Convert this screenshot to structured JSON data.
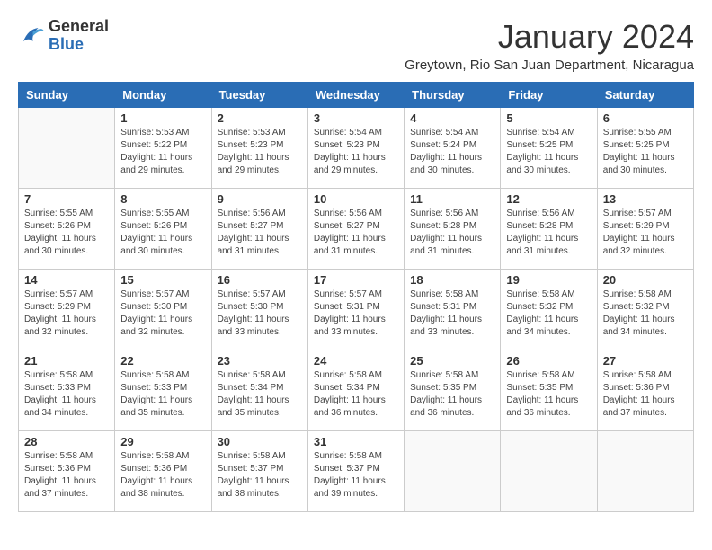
{
  "logo": {
    "general": "General",
    "blue": "Blue"
  },
  "title": "January 2024",
  "subtitle": "Greytown, Rio San Juan Department, Nicaragua",
  "days_of_week": [
    "Sunday",
    "Monday",
    "Tuesday",
    "Wednesday",
    "Thursday",
    "Friday",
    "Saturday"
  ],
  "weeks": [
    [
      {
        "day": "",
        "info": ""
      },
      {
        "day": "1",
        "info": "Sunrise: 5:53 AM\nSunset: 5:22 PM\nDaylight: 11 hours\nand 29 minutes."
      },
      {
        "day": "2",
        "info": "Sunrise: 5:53 AM\nSunset: 5:23 PM\nDaylight: 11 hours\nand 29 minutes."
      },
      {
        "day": "3",
        "info": "Sunrise: 5:54 AM\nSunset: 5:23 PM\nDaylight: 11 hours\nand 29 minutes."
      },
      {
        "day": "4",
        "info": "Sunrise: 5:54 AM\nSunset: 5:24 PM\nDaylight: 11 hours\nand 30 minutes."
      },
      {
        "day": "5",
        "info": "Sunrise: 5:54 AM\nSunset: 5:25 PM\nDaylight: 11 hours\nand 30 minutes."
      },
      {
        "day": "6",
        "info": "Sunrise: 5:55 AM\nSunset: 5:25 PM\nDaylight: 11 hours\nand 30 minutes."
      }
    ],
    [
      {
        "day": "7",
        "info": "Sunrise: 5:55 AM\nSunset: 5:26 PM\nDaylight: 11 hours\nand 30 minutes."
      },
      {
        "day": "8",
        "info": "Sunrise: 5:55 AM\nSunset: 5:26 PM\nDaylight: 11 hours\nand 30 minutes."
      },
      {
        "day": "9",
        "info": "Sunrise: 5:56 AM\nSunset: 5:27 PM\nDaylight: 11 hours\nand 31 minutes."
      },
      {
        "day": "10",
        "info": "Sunrise: 5:56 AM\nSunset: 5:27 PM\nDaylight: 11 hours\nand 31 minutes."
      },
      {
        "day": "11",
        "info": "Sunrise: 5:56 AM\nSunset: 5:28 PM\nDaylight: 11 hours\nand 31 minutes."
      },
      {
        "day": "12",
        "info": "Sunrise: 5:56 AM\nSunset: 5:28 PM\nDaylight: 11 hours\nand 31 minutes."
      },
      {
        "day": "13",
        "info": "Sunrise: 5:57 AM\nSunset: 5:29 PM\nDaylight: 11 hours\nand 32 minutes."
      }
    ],
    [
      {
        "day": "14",
        "info": "Sunrise: 5:57 AM\nSunset: 5:29 PM\nDaylight: 11 hours\nand 32 minutes."
      },
      {
        "day": "15",
        "info": "Sunrise: 5:57 AM\nSunset: 5:30 PM\nDaylight: 11 hours\nand 32 minutes."
      },
      {
        "day": "16",
        "info": "Sunrise: 5:57 AM\nSunset: 5:30 PM\nDaylight: 11 hours\nand 33 minutes."
      },
      {
        "day": "17",
        "info": "Sunrise: 5:57 AM\nSunset: 5:31 PM\nDaylight: 11 hours\nand 33 minutes."
      },
      {
        "day": "18",
        "info": "Sunrise: 5:58 AM\nSunset: 5:31 PM\nDaylight: 11 hours\nand 33 minutes."
      },
      {
        "day": "19",
        "info": "Sunrise: 5:58 AM\nSunset: 5:32 PM\nDaylight: 11 hours\nand 34 minutes."
      },
      {
        "day": "20",
        "info": "Sunrise: 5:58 AM\nSunset: 5:32 PM\nDaylight: 11 hours\nand 34 minutes."
      }
    ],
    [
      {
        "day": "21",
        "info": "Sunrise: 5:58 AM\nSunset: 5:33 PM\nDaylight: 11 hours\nand 34 minutes."
      },
      {
        "day": "22",
        "info": "Sunrise: 5:58 AM\nSunset: 5:33 PM\nDaylight: 11 hours\nand 35 minutes."
      },
      {
        "day": "23",
        "info": "Sunrise: 5:58 AM\nSunset: 5:34 PM\nDaylight: 11 hours\nand 35 minutes."
      },
      {
        "day": "24",
        "info": "Sunrise: 5:58 AM\nSunset: 5:34 PM\nDaylight: 11 hours\nand 36 minutes."
      },
      {
        "day": "25",
        "info": "Sunrise: 5:58 AM\nSunset: 5:35 PM\nDaylight: 11 hours\nand 36 minutes."
      },
      {
        "day": "26",
        "info": "Sunrise: 5:58 AM\nSunset: 5:35 PM\nDaylight: 11 hours\nand 36 minutes."
      },
      {
        "day": "27",
        "info": "Sunrise: 5:58 AM\nSunset: 5:36 PM\nDaylight: 11 hours\nand 37 minutes."
      }
    ],
    [
      {
        "day": "28",
        "info": "Sunrise: 5:58 AM\nSunset: 5:36 PM\nDaylight: 11 hours\nand 37 minutes."
      },
      {
        "day": "29",
        "info": "Sunrise: 5:58 AM\nSunset: 5:36 PM\nDaylight: 11 hours\nand 38 minutes."
      },
      {
        "day": "30",
        "info": "Sunrise: 5:58 AM\nSunset: 5:37 PM\nDaylight: 11 hours\nand 38 minutes."
      },
      {
        "day": "31",
        "info": "Sunrise: 5:58 AM\nSunset: 5:37 PM\nDaylight: 11 hours\nand 39 minutes."
      },
      {
        "day": "",
        "info": ""
      },
      {
        "day": "",
        "info": ""
      },
      {
        "day": "",
        "info": ""
      }
    ]
  ]
}
